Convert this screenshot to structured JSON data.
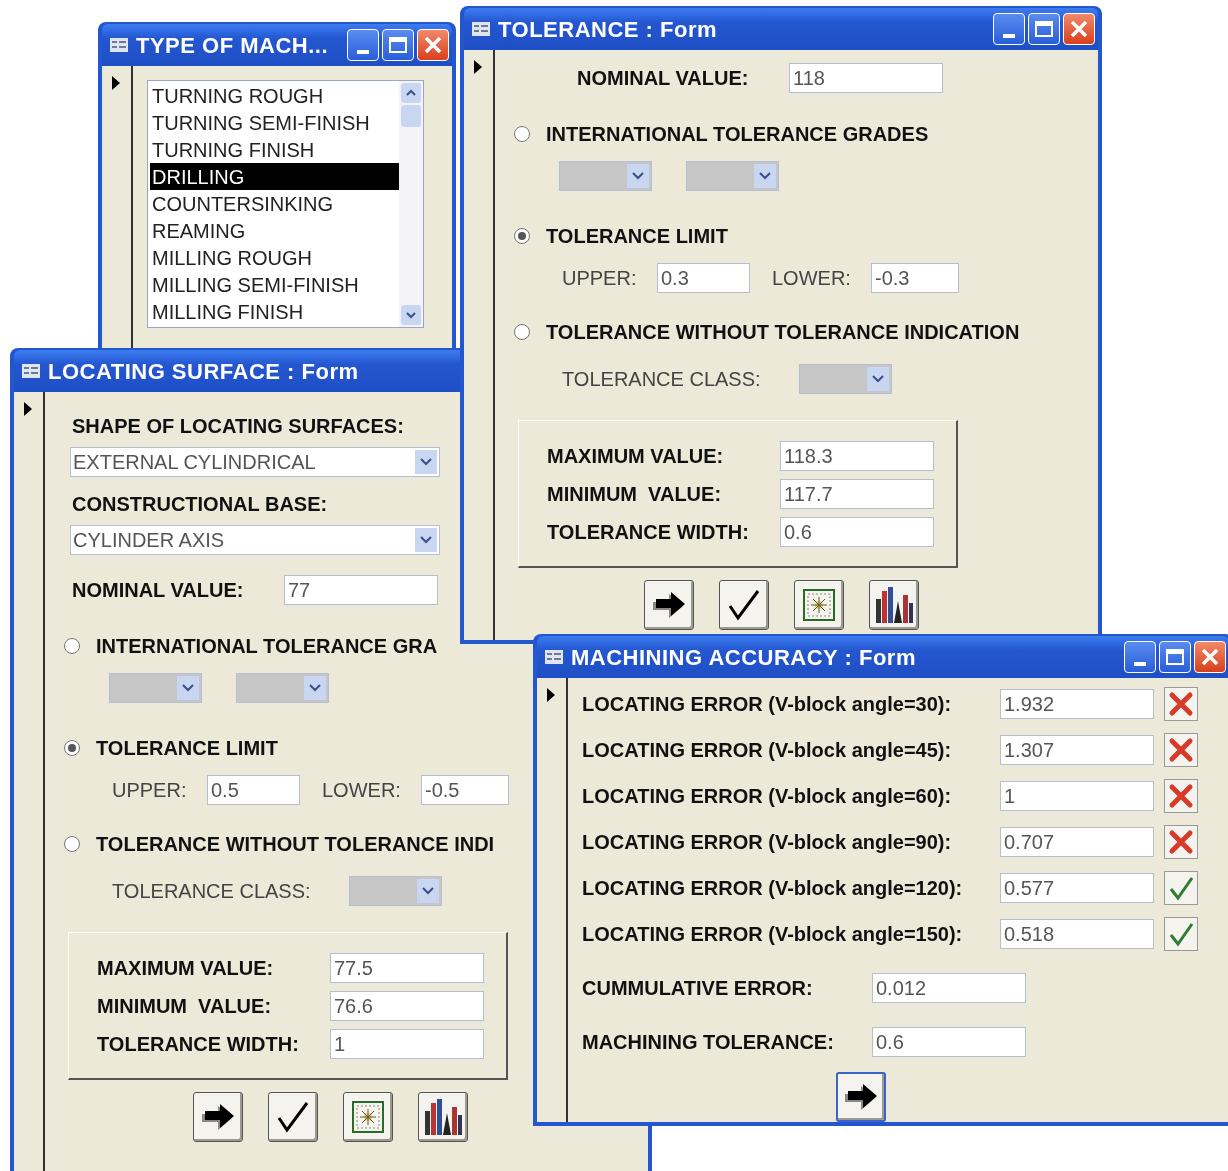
{
  "type_of_machining": {
    "title": "TYPE OF MACH...",
    "items": [
      {
        "label": "TURNING ROUGH",
        "selected": false
      },
      {
        "label": "TURNING SEMI-FINISH",
        "selected": false
      },
      {
        "label": "TURNING FINISH",
        "selected": false
      },
      {
        "label": "DRILLING",
        "selected": true
      },
      {
        "label": "COUNTERSINKING",
        "selected": false
      },
      {
        "label": "REAMING",
        "selected": false
      },
      {
        "label": "MILLING ROUGH",
        "selected": false
      },
      {
        "label": "MILLING SEMI-FINISH",
        "selected": false
      },
      {
        "label": "MILLING FINISH",
        "selected": false
      }
    ]
  },
  "tolerance_form": {
    "title": "TOLERANCE : Form",
    "nominal": {
      "label": "NOMINAL VALUE:",
      "value": "118"
    },
    "options": [
      {
        "label": "INTERNATIONAL TOLERANCE GRADES",
        "selected": false
      },
      {
        "label": "TOLERANCE LIMIT",
        "selected": true
      },
      {
        "label": "TOLERANCE WITHOUT TOLERANCE INDICATION",
        "selected": false
      }
    ],
    "grade_dropdowns": [
      {
        "disabled": true
      },
      {
        "disabled": true
      }
    ],
    "upper": {
      "label": "UPPER:",
      "value": "0.3"
    },
    "lower": {
      "label": "LOWER:",
      "value": "-0.3"
    },
    "tolerance_class": {
      "label": "TOLERANCE CLASS:",
      "disabled": true
    },
    "results": [
      {
        "label": "MAXIMUM VALUE:",
        "value": "118.3"
      },
      {
        "label": "MINIMUM  VALUE:",
        "value": "117.7"
      },
      {
        "label": "TOLERANCE WIDTH:",
        "value": "0.6"
      }
    ],
    "buttons": [
      {
        "kind": "next",
        "focused": false
      },
      {
        "kind": "accept",
        "focused": false
      },
      {
        "kind": "picture",
        "focused": false
      },
      {
        "kind": "chart",
        "focused": false
      }
    ]
  },
  "locating_surface_form": {
    "title": "LOCATING SURFACE : Form",
    "shape": {
      "label": "SHAPE OF LOCATING SURFACES:",
      "value": "EXTERNAL CYLINDRICAL",
      "disabled": false
    },
    "base": {
      "label": "CONSTRUCTIONAL BASE:",
      "value": "CYLINDER AXIS",
      "disabled": false
    },
    "nominal": {
      "label": "NOMINAL VALUE:",
      "value": "77"
    },
    "options": [
      {
        "label": "INTERNATIONAL TOLERANCE GRA",
        "selected": false
      },
      {
        "label": "TOLERANCE LIMIT",
        "selected": true
      },
      {
        "label": "TOLERANCE WITHOUT TOLERANCE INDI",
        "selected": false
      }
    ],
    "grade_dropdowns": [
      {
        "disabled": true
      },
      {
        "disabled": true
      }
    ],
    "upper": {
      "label": "UPPER:",
      "value": "0.5"
    },
    "lower": {
      "label": "LOWER:",
      "value": "-0.5"
    },
    "tolerance_class": {
      "label": "TOLERANCE CLASS:",
      "disabled": true
    },
    "results": [
      {
        "label": "MAXIMUM VALUE:",
        "value": "77.5"
      },
      {
        "label": "MINIMUM  VALUE:",
        "value": "76.6"
      },
      {
        "label": "TOLERANCE WIDTH:",
        "value": "1"
      }
    ],
    "buttons": [
      {
        "kind": "next",
        "focused": false
      },
      {
        "kind": "accept",
        "focused": false
      },
      {
        "kind": "picture",
        "focused": false
      },
      {
        "kind": "chart",
        "focused": false
      }
    ]
  },
  "machining_accuracy_form": {
    "title": "MACHINING ACCURACY : Form",
    "errors": [
      {
        "label": "LOCATING ERROR (V-block angle=30):",
        "value": "1.932",
        "ok": false
      },
      {
        "label": "LOCATING ERROR (V-block angle=45):",
        "value": "1.307",
        "ok": false
      },
      {
        "label": "LOCATING ERROR (V-block angle=60):",
        "value": "1",
        "ok": false
      },
      {
        "label": "LOCATING ERROR (V-block angle=90):",
        "value": "0.707",
        "ok": false
      },
      {
        "label": "LOCATING ERROR (V-block angle=120):",
        "value": "0.577",
        "ok": true
      },
      {
        "label": "LOCATING ERROR (V-block angle=150):",
        "value": "0.518",
        "ok": true
      }
    ],
    "cumulative": {
      "label": "CUMMULATIVE ERROR:",
      "value": "0.012"
    },
    "machining_tolerance": {
      "label": "MACHINING TOLERANCE:",
      "value": "0.6"
    },
    "buttons": [
      {
        "kind": "next",
        "focused": true
      }
    ]
  }
}
